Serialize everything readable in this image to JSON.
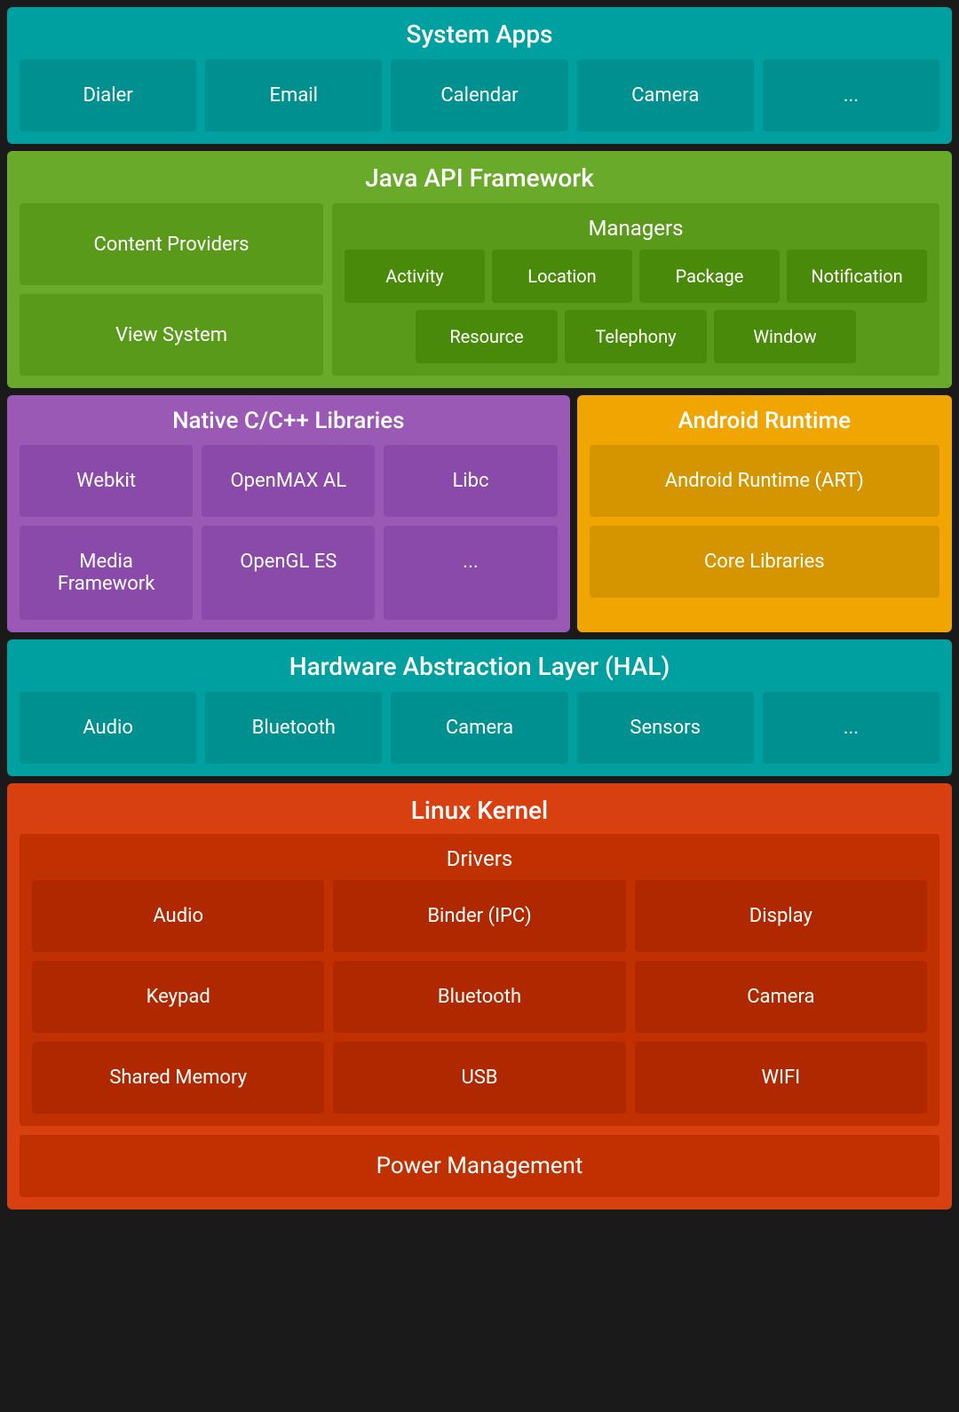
{
  "system_apps": {
    "title": "System Apps",
    "apps": [
      "Dialer",
      "Email",
      "Calendar",
      "Camera",
      "..."
    ]
  },
  "java_api": {
    "title": "Java API Framework",
    "left": {
      "tiles": [
        "Content Providers",
        "View System"
      ]
    },
    "managers": {
      "title": "Managers",
      "row1": [
        "Activity",
        "Location",
        "Package",
        "Notification"
      ],
      "row2": [
        "Resource",
        "Telephony",
        "Window"
      ]
    }
  },
  "native_cpp": {
    "title": "Native C/C++ Libraries",
    "tiles": [
      "Webkit",
      "OpenMAX AL",
      "Libc",
      "Media Framework",
      "OpenGL ES",
      "..."
    ]
  },
  "android_runtime": {
    "title": "Android Runtime",
    "tiles": [
      "Android Runtime (ART)",
      "Core Libraries"
    ]
  },
  "hal": {
    "title": "Hardware Abstraction Layer (HAL)",
    "tiles": [
      "Audio",
      "Bluetooth",
      "Camera",
      "Sensors",
      "..."
    ]
  },
  "linux_kernel": {
    "title": "Linux Kernel",
    "drivers": {
      "title": "Drivers",
      "tiles": [
        "Audio",
        "Binder (IPC)",
        "Display",
        "Keypad",
        "Bluetooth",
        "Camera",
        "Shared Memory",
        "USB",
        "WIFI"
      ]
    },
    "power_management": "Power Management"
  }
}
